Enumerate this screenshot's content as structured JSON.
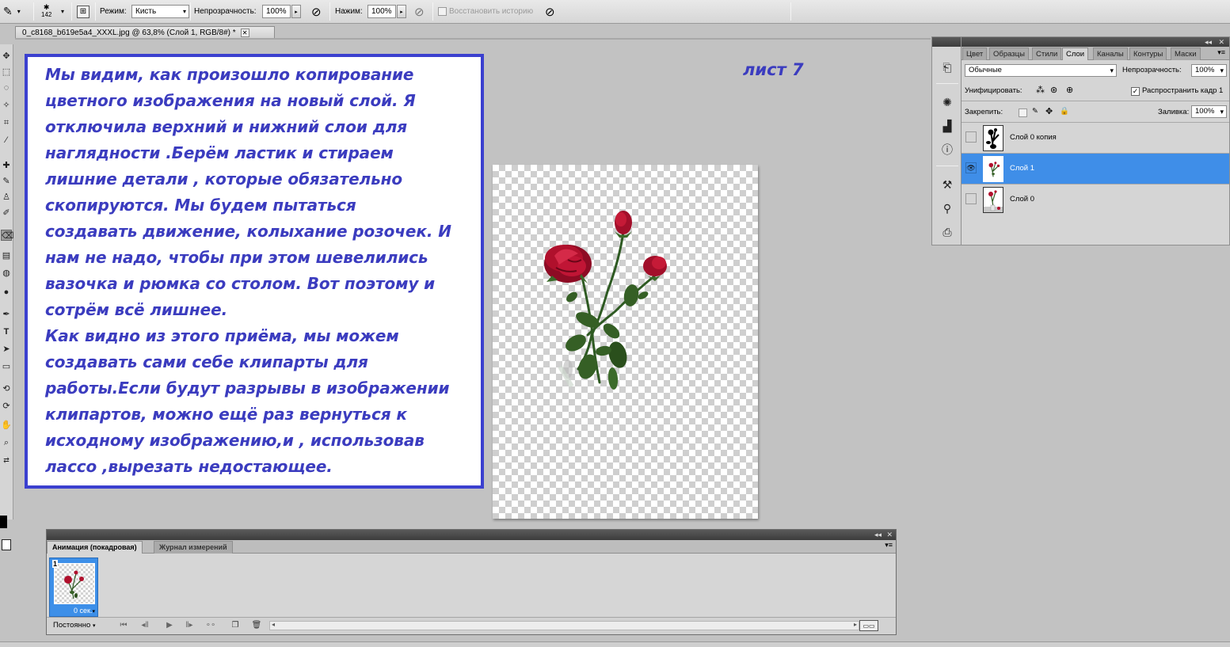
{
  "options_bar": {
    "brush_size": "142",
    "mode_label": "Режим:",
    "mode_value": "Кисть",
    "opacity_label": "Непрозрачность:",
    "opacity_value": "100%",
    "flow_label": "Нажим:",
    "flow_value": "100%",
    "restore_history_label": "Восстановить историю"
  },
  "document_tab": {
    "title": "0_c8168_b619e5a4_XXXL.jpg @ 63,8% (Слой 1, RGB/8#) *"
  },
  "note": {
    "lines": [
      "Мы видим, как произошло копирование",
      "цветного изображения на новый слой. Я",
      "отключила верхний и нижний слои для",
      "наглядности .Берём ластик и стираем",
      "лишние детали , которые обязательно",
      "скопируются. Мы будем пытаться",
      "создавать движение, колыхание розочек. И",
      "нам не надо, чтобы при этом шевелились",
      "вазочка и рюмка со столом. Вот поэтому и",
      "сотрём всё лишнее.",
      "Как  видно из этого приёма, мы можем",
      "создавать сами себе клипарты для",
      "работы.Если будут разрывы в изображении",
      "клипартов, можно ещё раз вернуться к",
      "исходному изображению,и , использовав",
      "лассо ,вырезать недостающее."
    ],
    "sheet_label": "лист 7"
  },
  "animation_panel": {
    "tabs": [
      "Анимация (покадровая)",
      "Журнал измерений"
    ],
    "frame_number": "1",
    "frame_delay": "0 сек.",
    "loop_option": "Постоянно"
  },
  "layers_panel": {
    "tabs": [
      "Цвет",
      "Образцы",
      "Стили",
      "Слои",
      "Каналы",
      "Контуры",
      "Маски"
    ],
    "active_tab": "Слои",
    "blend_mode": "Обычные",
    "opacity_label": "Непрозрачность:",
    "opacity_value": "100%",
    "unify_label": "Унифицировать:",
    "propagate_label": "Распространить кадр 1",
    "lock_label": "Закрепить:",
    "fill_label": "Заливка:",
    "fill_value": "100%",
    "layers": [
      {
        "name": "Слой 0 копия",
        "visible": false,
        "selected": false
      },
      {
        "name": "Слой 1",
        "visible": true,
        "selected": true
      },
      {
        "name": "Слой 0",
        "visible": false,
        "selected": false
      }
    ]
  },
  "colors": {
    "note_border": "#3b40cf",
    "note_text": "#3b3cbf",
    "selection_blue": "#3f8ee8",
    "rose_red": "#b0102c",
    "leaf_green": "#2f5a22"
  }
}
